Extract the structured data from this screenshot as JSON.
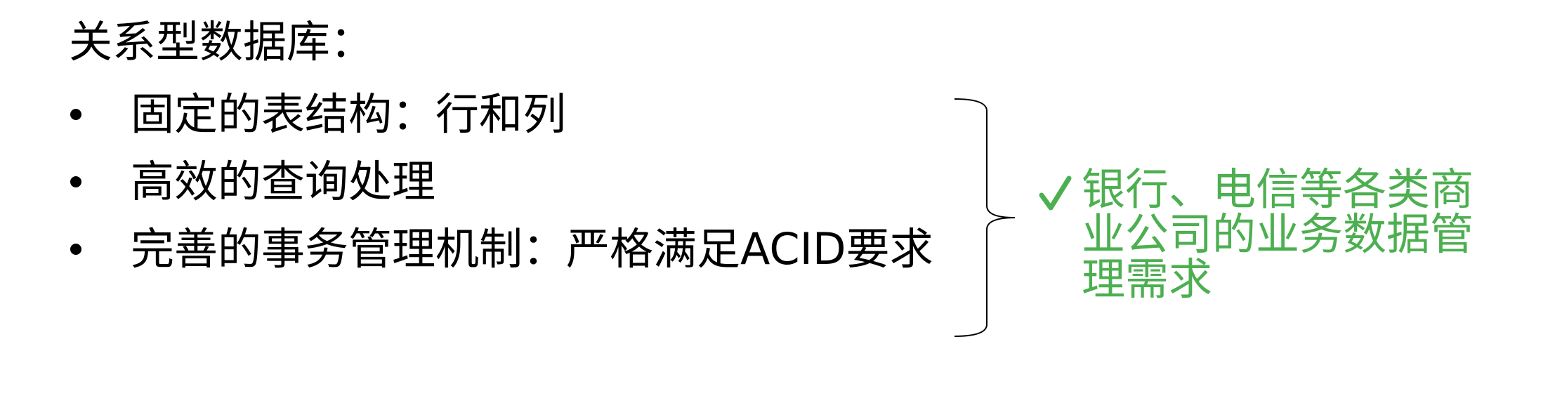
{
  "heading": "关系型数据库：",
  "bullets": [
    {
      "text": "固定的表结构：行和列"
    },
    {
      "text": "高效的查询处理"
    },
    {
      "text": "完善的事务管理机制：严格满足ACID要求"
    }
  ],
  "conclusion": {
    "icon": "check-icon",
    "text": "银行、电信等各类商业公司的业务数据管理需求",
    "color": "#4caf50"
  }
}
